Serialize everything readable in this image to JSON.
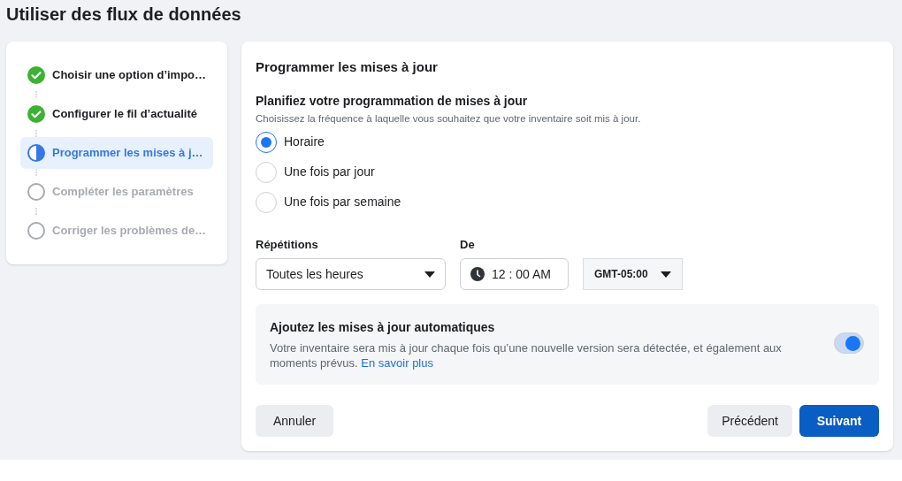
{
  "page_title": "Utiliser des flux de données",
  "steps": [
    {
      "label": "Choisir une option d’impo…",
      "kind": "done",
      "selected": false
    },
    {
      "label": "Configurer le fil d’actualité",
      "kind": "done",
      "selected": false
    },
    {
      "label": "Programmer les mises à j…",
      "kind": "current",
      "selected": true
    },
    {
      "label": "Compléter les paramètres",
      "kind": "todo",
      "selected": false
    },
    {
      "label": "Corriger les problèmes de…",
      "kind": "todo",
      "selected": false
    }
  ],
  "panel": {
    "title": "Programmer les mises à jour",
    "question": "Planifiez votre programmation de mises à jour",
    "hint": "Choisissez la fréquence à laquelle vous souhaitez que votre inventaire soit mis à jour.",
    "options": [
      {
        "label": "Horaire",
        "selected": true
      },
      {
        "label": "Une fois par jour",
        "selected": false
      },
      {
        "label": "Une fois par semaine",
        "selected": false
      }
    ],
    "repeat": {
      "label": "Répétitions",
      "value": "Toutes les heures"
    },
    "from": {
      "label": "De",
      "time": "12 : 00 AM",
      "timezone": "GMT-05:00"
    },
    "auto": {
      "title": "Ajoutez les mises à jour automatiques",
      "text": "Votre inventaire sera mis à jour chaque fois qu’une nouvelle version sera détectée, et également aux moments prévus.",
      "link": "En savoir plus",
      "on": true
    }
  },
  "buttons": {
    "cancel": "Annuler",
    "previous": "Précédent",
    "next": "Suivant"
  }
}
